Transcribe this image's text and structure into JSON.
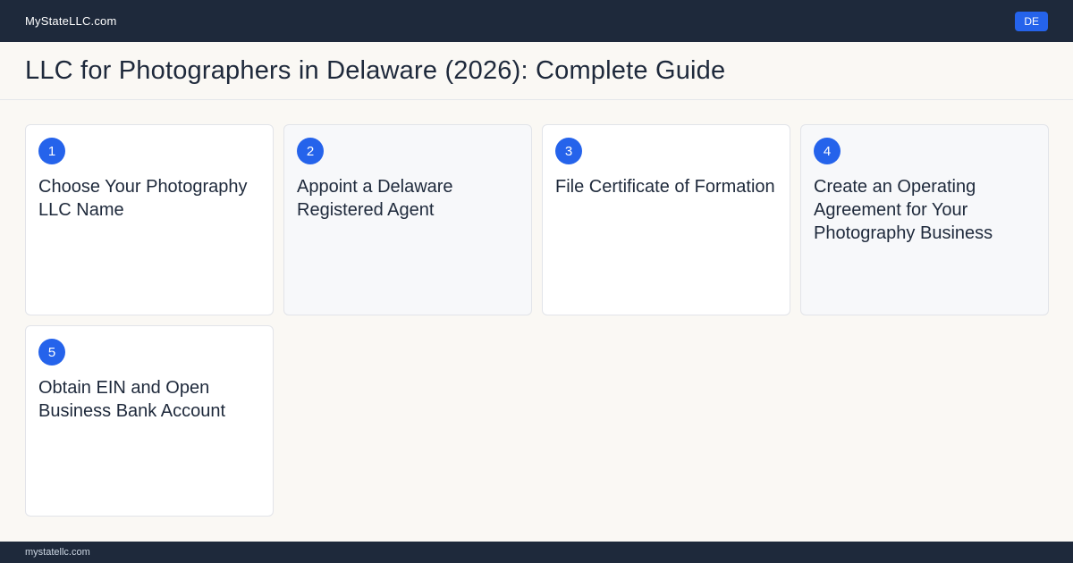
{
  "header": {
    "brand": "MyStateLLC.com",
    "state_badge": "DE"
  },
  "page": {
    "title": "LLC for Photographers in Delaware (2026): Complete Guide"
  },
  "steps": [
    {
      "number": "1",
      "title": "Choose Your Photography LLC Name"
    },
    {
      "number": "2",
      "title": "Appoint a Delaware Registered Agent"
    },
    {
      "number": "3",
      "title": "File Certificate of Formation"
    },
    {
      "number": "4",
      "title": "Create an Operating Agreement for Your Photography Business"
    },
    {
      "number": "5",
      "title": "Obtain EIN and Open Business Bank Account"
    }
  ],
  "footer": {
    "text": "mystatellc.com"
  },
  "colors": {
    "accent": "#2563eb",
    "dark": "#1e293b"
  }
}
